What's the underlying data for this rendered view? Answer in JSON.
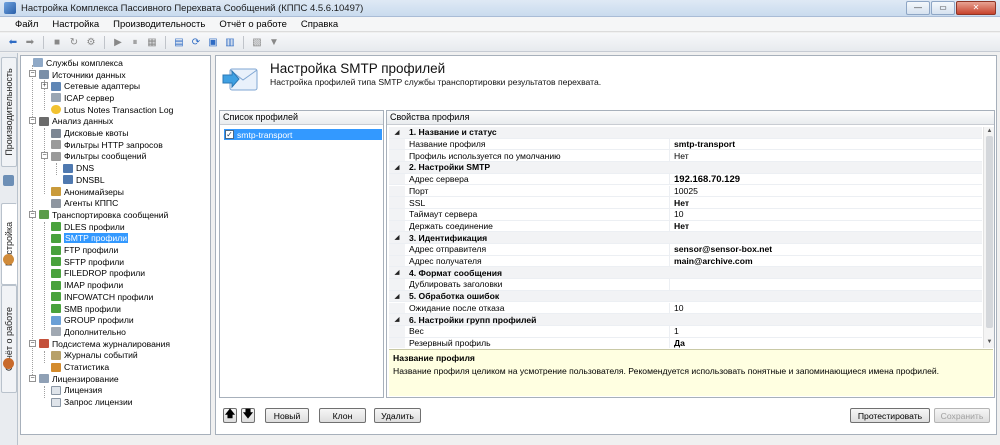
{
  "window": {
    "title": "Настройка Комплекса Пассивного Перехвата Сообщений (КППС 4.5.6.10497)",
    "minimize": "—",
    "maximize": "▭",
    "close": "✕"
  },
  "menu": [
    "Файл",
    "Настройка",
    "Производительность",
    "Отчёт о работе",
    "Справка"
  ],
  "vertical_tabs": [
    {
      "label": "Производительность"
    },
    {
      "label": "Настройка"
    },
    {
      "label": "Отчёт о работе"
    }
  ],
  "tree": [
    {
      "label": "Службы комплекса",
      "icon": "service-icon"
    },
    {
      "label": "Источники данных",
      "icon": "data-sources-icon"
    },
    {
      "label": "Сетевые адаптеры",
      "icon": "network-adapter-icon"
    },
    {
      "label": "ICAP сервер",
      "icon": "icap-icon"
    },
    {
      "label": "Lotus Notes Transaction Log",
      "icon": "lotus-icon"
    },
    {
      "label": "Анализ данных",
      "icon": "analysis-icon"
    },
    {
      "label": "Дисковые квоты",
      "icon": "disk-icon"
    },
    {
      "label": "Фильтры HTTP запросов",
      "icon": "filter-icon"
    },
    {
      "label": "Фильтры сообщений",
      "icon": "filter-icon"
    },
    {
      "label": "DNS",
      "icon": "dns-icon"
    },
    {
      "label": "DNSBL",
      "icon": "dnsbl-icon"
    },
    {
      "label": "Анонимайзеры",
      "icon": "anonymizer-icon"
    },
    {
      "label": "Агенты КППС",
      "icon": "agent-icon"
    },
    {
      "label": "Транспортировка сообщений",
      "icon": "transport-icon"
    },
    {
      "label": "DLES профили",
      "icon": "profile-icon"
    },
    {
      "label": "SMTP профили",
      "icon": "profile-icon"
    },
    {
      "label": "FTP профили",
      "icon": "profile-icon"
    },
    {
      "label": "SFTP профили",
      "icon": "profile-icon"
    },
    {
      "label": "FILEDROP профили",
      "icon": "profile-icon"
    },
    {
      "label": "IMAP профили",
      "icon": "profile-icon"
    },
    {
      "label": "INFOWATCH профили",
      "icon": "profile-icon"
    },
    {
      "label": "SMB профили",
      "icon": "profile-icon"
    },
    {
      "label": "GROUP профили",
      "icon": "group-icon"
    },
    {
      "label": "Дополнительно",
      "icon": "misc-icon"
    },
    {
      "label": "Подсистема журналирования",
      "icon": "logging-icon"
    },
    {
      "label": "Журналы событий",
      "icon": "log-icon"
    },
    {
      "label": "Статистика",
      "icon": "stats-icon"
    },
    {
      "label": "Лицензирование",
      "icon": "license-icon"
    },
    {
      "label": "Лицензия",
      "icon": "license-doc-icon"
    },
    {
      "label": "Запрос лицензии",
      "icon": "license-request-icon"
    }
  ],
  "header": {
    "title": "Настройка SMTP профилей",
    "subtitle": "Настройка профилей типа SMTP службы транспортировки результатов перехвата."
  },
  "profiles_pane": {
    "title": "Список профилей",
    "items": [
      {
        "label": "smtp-transport",
        "checked": "✓"
      }
    ]
  },
  "props_pane": {
    "title": "Свойства профиля",
    "rows": [
      {
        "name": "1. Название и статус",
        "value": ""
      },
      {
        "name": "Название профиля",
        "value": "smtp-transport"
      },
      {
        "name": "Профиль используется по умолчанию",
        "value": "Нет"
      },
      {
        "name": "2. Настройки SMTP",
        "value": ""
      },
      {
        "name": "Адрес сервера",
        "value": "192.168.70.129"
      },
      {
        "name": "Порт",
        "value": "10025"
      },
      {
        "name": "SSL",
        "value": "Нет"
      },
      {
        "name": "Таймаут сервера",
        "value": "10"
      },
      {
        "name": "Держать соединение",
        "value": "Нет"
      },
      {
        "name": "3. Идентификация",
        "value": ""
      },
      {
        "name": "Адрес отправителя",
        "value": "sensor@sensor-box.net"
      },
      {
        "name": "Адрес получателя",
        "value": "main@archive.com"
      },
      {
        "name": "4. Формат сообщения",
        "value": ""
      },
      {
        "name": "Дублировать заголовки",
        "value": ""
      },
      {
        "name": "5. Обработка ошибок",
        "value": ""
      },
      {
        "name": "Ожидание после отказа",
        "value": "10"
      },
      {
        "name": "6. Настройки групп профилей",
        "value": ""
      },
      {
        "name": "Вес",
        "value": "1"
      },
      {
        "name": "Резервный профиль",
        "value": "Да"
      }
    ],
    "description_title": "Название профиля",
    "description_text": "Название профиля целиком на усмотрение пользователя. Рекомендуется использовать понятные и запоминающиеся имена профилей."
  },
  "buttons": {
    "up": "🡅",
    "down": "🡇",
    "new": "Новый",
    "clone": "Клон",
    "delete": "Удалить",
    "test": "Протестировать",
    "save": "Сохранить"
  },
  "colors": {
    "selection": "#3399ff",
    "description_bg": "#ffffe1"
  }
}
